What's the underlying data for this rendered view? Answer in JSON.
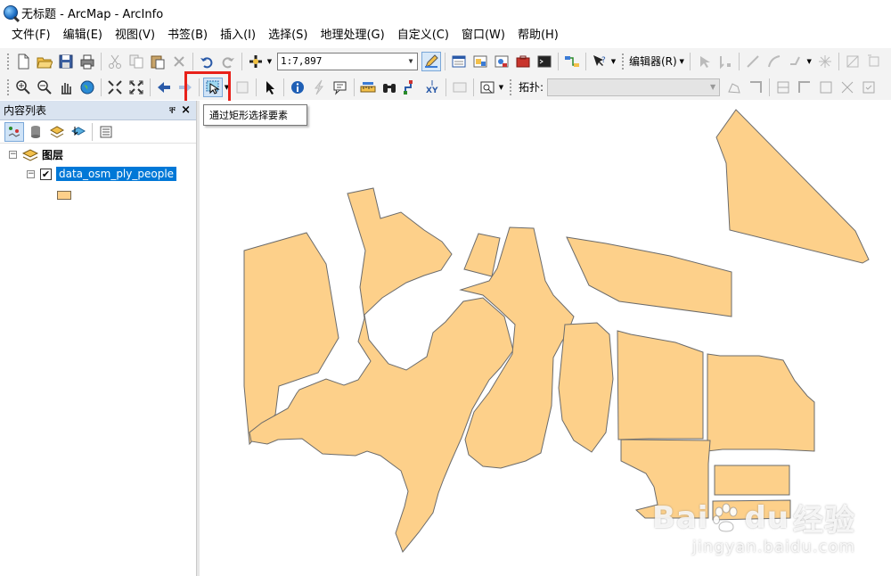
{
  "window": {
    "title": "无标题 - ArcMap - ArcInfo"
  },
  "menubar": {
    "items": [
      "文件(F)",
      "编辑(E)",
      "视图(V)",
      "书签(B)",
      "插入(I)",
      "选择(S)",
      "地理处理(G)",
      "自定义(C)",
      "窗口(W)",
      "帮助(H)"
    ]
  },
  "toolbar": {
    "scale_value": "1:7,897",
    "editor_label": "编辑器(R)",
    "topology_label": "拓扑:"
  },
  "tooltip": {
    "text": "通过矩形选择要素"
  },
  "toc": {
    "title": "内容列表",
    "pin_glyph": "ቐ",
    "close_glyph": "×",
    "layers_group": "图层",
    "layer_name": "data_osm_ply_people",
    "layer_checked": "✔"
  },
  "map": {
    "fill_color": "#fdd08a",
    "stroke_color": "#6b6b6b"
  },
  "watermark": {
    "main": "Bai",
    "main2": "du",
    "suffix": "经验",
    "sub": "jingyan.baidu.com"
  }
}
